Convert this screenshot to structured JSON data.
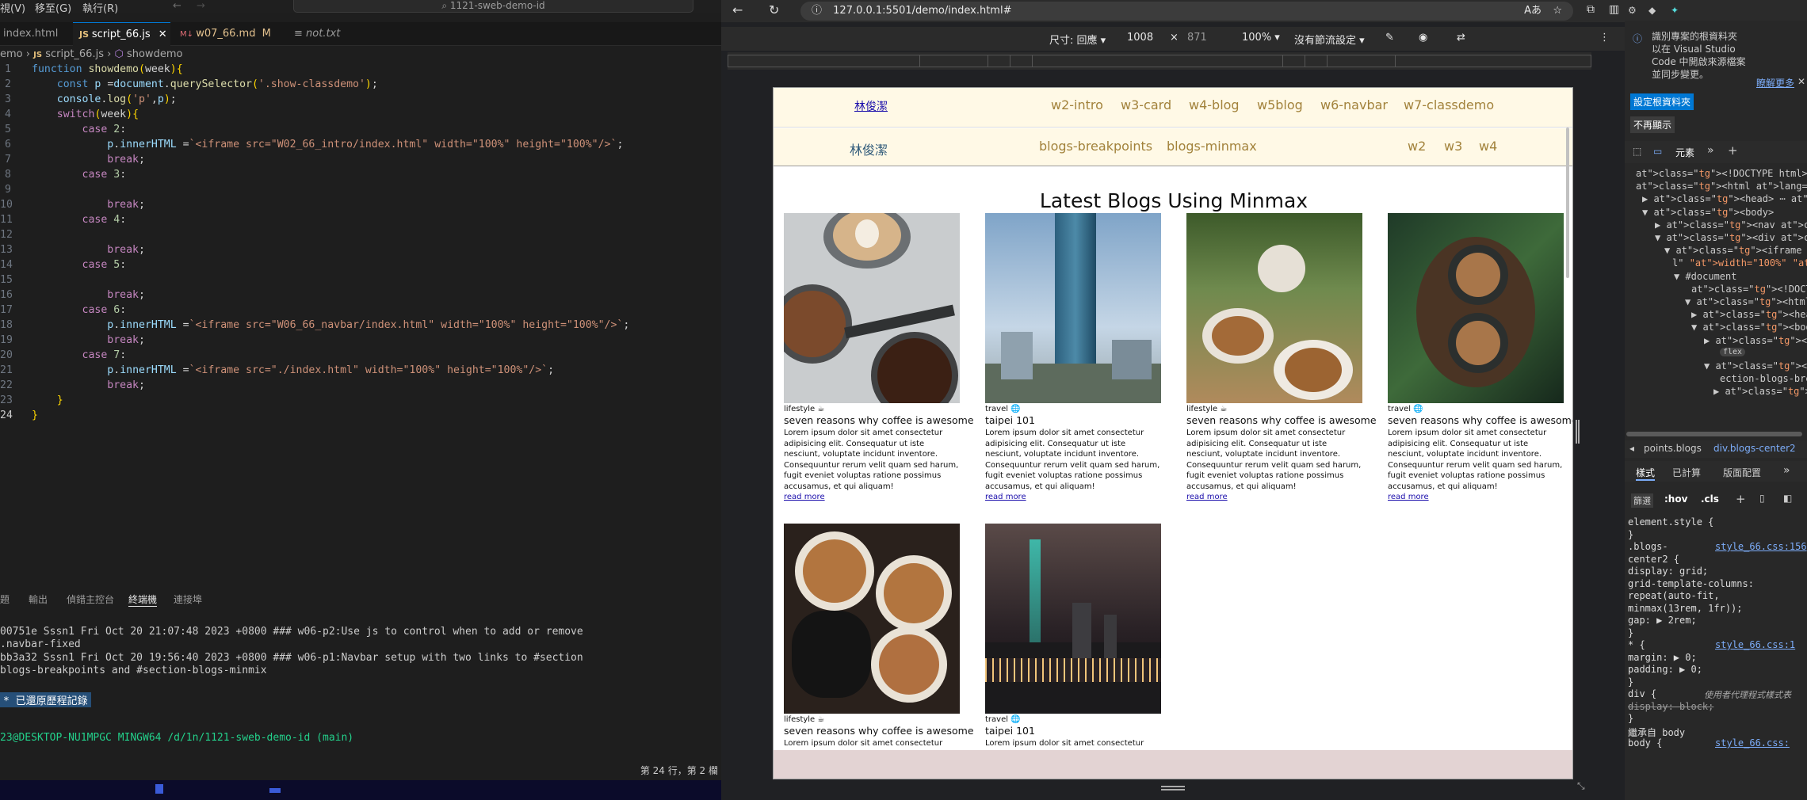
{
  "vscode": {
    "menus": [
      "視(V)",
      "移至(G)",
      "執行(R)"
    ],
    "search_placeholder": "1121-sweb-demo-id",
    "tabs": [
      {
        "label": "index.html",
        "active": false
      },
      {
        "label": "script_66.js",
        "active": true
      },
      {
        "label": "w07_66.md",
        "status": "M",
        "active": false
      },
      {
        "label": "not.txt",
        "active": false
      }
    ],
    "breadcrumb": [
      "emo",
      "script_66.js",
      "showdemo"
    ],
    "code": [
      "function showdemo(week){",
      "    const p =document.querySelector('.show-classdemo');",
      "    console.log('p',p);",
      "    switch(week){",
      "        case 2:",
      "            p.innerHTML =`<iframe src=\"W02_66_intro/index.html\" width=\"100%\" height=\"100%\"/>`;",
      "            break;",
      "        case 3:",
      "",
      "            break;",
      "        case 4:",
      "",
      "            break;",
      "        case 5:",
      "",
      "            break;",
      "        case 6:",
      "            p.innerHTML =`<iframe src=\"W06_66_navbar/index.html\" width=\"100%\" height=\"100%\"/>`;",
      "            break;",
      "        case 7:",
      "            p.innerHTML =`<iframe src=\"./index.html\" width=\"100%\" height=\"100%\"/>`;",
      "            break;",
      "    }",
      "}"
    ],
    "panel_tabs": [
      "題",
      "輸出",
      "偵錯主控台",
      "終端機",
      "連接埠"
    ],
    "terminal": [
      "00751e Sssn1   Fri Oct 20 21:07:48 2023 +0800  ### w06-p2:Use js to control when to add or remove",
      ".navbar-fixed",
      "bb3a32 Sssn1   Fri Oct 20 19:56:40 2023 +0800  ### w06-p1:Navbar setup with two links to #section",
      "blogs-breakpoints and #section-blogs-minmix",
      "* 已還原歷程記錄",
      "",
      "23@DESKTOP-NU1MPGC MINGW64 /d/1n/1121-sweb-demo-id (main)"
    ],
    "status_right": "第 24 行，第 2 欄"
  },
  "browser": {
    "url": "127.0.0.1:5501/demo/index.html#",
    "device_toolbar": {
      "size_label": "尺寸: 回應",
      "width": "1008",
      "height": "871",
      "zoom": "100%",
      "throttle": "沒有節流設定"
    }
  },
  "page": {
    "nav1": {
      "brand": "林俊潔",
      "links": [
        "w2-intro",
        "w3-card",
        "w4-blog",
        "w5blog",
        "w6-navbar",
        "w7-classdemo"
      ]
    },
    "nav2": {
      "brand": "林俊潔",
      "center_links": [
        "blogs-breakpoints",
        "blogs-minmax"
      ],
      "right_links": [
        "w2",
        "w3",
        "w4"
      ]
    },
    "heading": "Latest Blogs Using Minmax",
    "body_text": "Lorem ipsum dolor sit amet consectetur adipisicing elit. Consequatur ut iste nesciunt, voluptate incidunt inventore. Consequuntur rerum velit quam sed harum, fugit eveniet voluptas ratione possimus accusamus, et qui aliquam!",
    "read_more": "read more",
    "cards": [
      {
        "tag": "lifestyle ☕",
        "title": "seven reasons why coffee is awesome",
        "image": "coffee-beans-latte"
      },
      {
        "tag": "travel 🌐",
        "title": "taipei 101",
        "image": "taipei-101-day"
      },
      {
        "tag": "lifestyle ☕",
        "title": "seven reasons why coffee is awesome",
        "image": "coffee-cups-plants"
      },
      {
        "tag": "travel 🌐",
        "title": "seven reasons why coffee is awesome",
        "image": "latte-top-view"
      },
      {
        "tag": "lifestyle ☕",
        "title": "seven reasons why coffee is awesome",
        "image": "coffee-cheers"
      },
      {
        "tag": "travel 🌐",
        "title": "taipei 101",
        "image": "taipei-101-night"
      }
    ],
    "card_short_text": "Lorem ipsum dolor sit amet consectetur"
  },
  "devtools": {
    "notice": [
      "識別專案的根資料夾",
      "以在 Visual Studio",
      "Code 中開啟來源檔案",
      "並同步變更。"
    ],
    "notice_more": "瞭解更多",
    "set_root_button": "設定根資料夾",
    "dismiss_button": "不再顯示",
    "tabs_label": "元素",
    "dom": [
      "<!DOCTYPE html>",
      "<html lang=\"en\">",
      "▶ <head> ⋯ </head>",
      "▼ <body>",
      "▶ <nav class=\"nav\"> ⋯ </nav>",
      "▼ <div class=\"show-classdemo\">",
      "▼ <iframe src=\"W06_66_navbar",
      "l\" width=\"100%\" height=",
      "▼ #document",
      "<!DOCTYPE html>",
      "▼ <html lang=\"en\">",
      "▶ <head> ⋯ </head>",
      "▼ <body>",
      "▶ <nav class=\"nav\"",
      "flex",
      "▼ <section class=\"",
      "ection-blogs-bre",
      "▶ <div class=\"se"
    ],
    "crumb": [
      "points.blogs",
      "div.blogs-center2"
    ],
    "style_tabs": [
      "樣式",
      "已計算",
      "版面配置"
    ],
    "filter": "篩選",
    "styles": [
      {
        "sel": "element.style {",
        "src": ""
      },
      {
        "sel": "}",
        "src": ""
      },
      {
        "sel": ".blogs-",
        "src": "style_66.css:156"
      },
      {
        "sel": "center2 {",
        "src": ""
      },
      {
        "sel": "  display: grid;",
        "src": ""
      },
      {
        "sel": "  grid-template-columns:",
        "src": ""
      },
      {
        "sel": "    repeat(auto-fit,",
        "src": ""
      },
      {
        "sel": "    minmax(13rem, 1fr));",
        "src": ""
      },
      {
        "sel": "  gap: ▶ 2rem;",
        "src": ""
      },
      {
        "sel": "}",
        "src": ""
      },
      {
        "sel": "* {",
        "src": "style_66.css:1"
      },
      {
        "sel": "  margin: ▶ 0;",
        "src": ""
      },
      {
        "sel": "  padding: ▶ 0;",
        "src": ""
      },
      {
        "sel": "}",
        "src": ""
      },
      {
        "sel": "div {",
        "src": "使用者代理程式樣式表"
      },
      {
        "sel": "  display: block;",
        "src": ""
      },
      {
        "sel": "}",
        "src": ""
      },
      {
        "sel": "繼承自 body",
        "src": ""
      },
      {
        "sel": "body {",
        "src": "style_66.css:"
      }
    ]
  }
}
